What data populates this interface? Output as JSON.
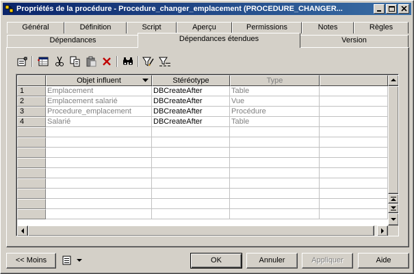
{
  "window": {
    "title": "Propriétés de la procédure - Procedure_changer_emplacement (PROCEDURE_CHANGER...",
    "minimize_icon": "minimize-icon",
    "maximize_icon": "maximize-icon",
    "close_icon": "close-icon"
  },
  "tabs_row1": [
    {
      "label": "Général"
    },
    {
      "label": "Définition"
    },
    {
      "label": "Script"
    },
    {
      "label": "Aperçu"
    },
    {
      "label": "Permissions"
    },
    {
      "label": "Notes"
    },
    {
      "label": "Règles"
    }
  ],
  "tabs_row2": [
    {
      "label": "Dépendances"
    },
    {
      "label": "Dépendances étendues",
      "active": true
    },
    {
      "label": "Version"
    }
  ],
  "toolbar": [
    "properties-icon",
    "add-rows-icon",
    "cut-icon",
    "copy-icon",
    "paste-icon",
    "delete-icon",
    "find-icon",
    "filter-icon",
    "filter-settings-icon"
  ],
  "grid": {
    "columns": [
      {
        "label": "Objet influent"
      },
      {
        "label": "Stéréotype"
      },
      {
        "label": "Type"
      }
    ],
    "rows": [
      {
        "num": "1",
        "object": "Emplacement",
        "stereotype": "DBCreateAfter",
        "type": "Table"
      },
      {
        "num": "2",
        "object": "Emplacement salarié",
        "stereotype": "DBCreateAfter",
        "type": "Vue"
      },
      {
        "num": "3",
        "object": "Procedure_emplacement",
        "stereotype": "DBCreateAfter",
        "type": "Procédure"
      },
      {
        "num": "4",
        "object": "Salarié",
        "stereotype": "DBCreateAfter",
        "type": "Table"
      }
    ]
  },
  "buttons": {
    "less": "<< Moins",
    "ok": "OK",
    "cancel": "Annuler",
    "apply": "Appliquer",
    "help": "Aide"
  }
}
